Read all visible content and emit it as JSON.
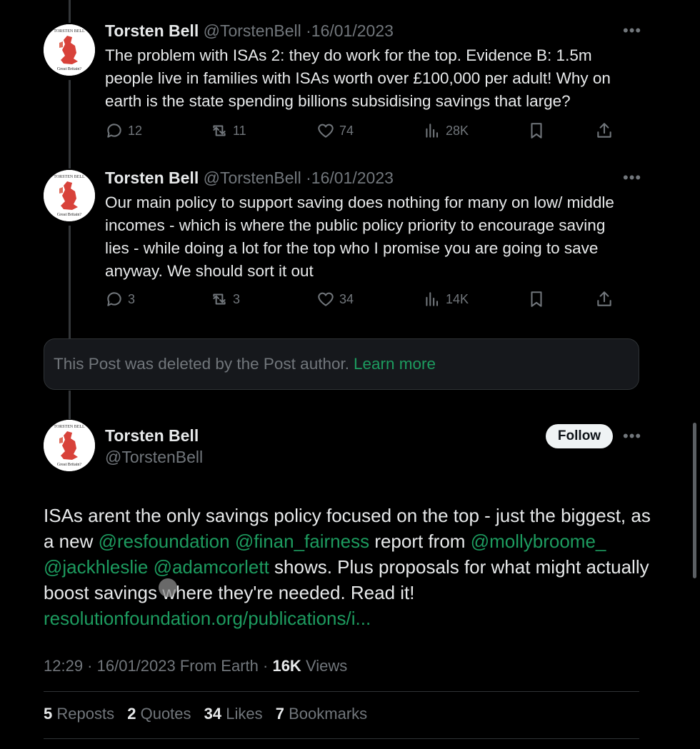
{
  "tweets": [
    {
      "name": "Torsten Bell",
      "handle": "@TorstenBell",
      "date_sep": "·",
      "date": "16/01/2023",
      "text": "The problem with ISAs 2: they do work for the top. Evidence B: 1.5m people live in families with ISAs worth over £100,000 per adult! Why on earth is the state spending billions subsidising savings that large?",
      "replies": "12",
      "reposts": "11",
      "likes": "74",
      "views": "28K"
    },
    {
      "name": "Torsten Bell",
      "handle": "@TorstenBell",
      "date_sep": "·",
      "date": "16/01/2023",
      "text": "Our main policy to support saving does nothing for many on low/ middle incomes - which is where the public policy priority to encourage saving lies - while doing a lot for the top who I promise you are going to save anyway. We should sort it out",
      "replies": "3",
      "reposts": "3",
      "likes": "34",
      "views": "14K"
    }
  ],
  "deleted_notice": {
    "text": "This Post was deleted by the Post author.",
    "link": "Learn more"
  },
  "main_tweet": {
    "name": "Torsten Bell",
    "handle": "@TorstenBell",
    "follow_label": "Follow",
    "text_1": "ISAs arent the only savings policy focused on the top - just the biggest, as a new ",
    "mention_1": "@resfoundation",
    "mention_2": "@finan_fairness",
    "text_2": " report from ",
    "mention_3": "@mollybroome_",
    "mention_4": "@jackhleslie",
    "mention_5": "@adamcorlett",
    "text_3": " shows. Plus proposals for what might actually boost savings where they're needed. Read it!",
    "url": "resolutionfoundation.org/publications/i...",
    "time": "12:29",
    "date": "16/01/2023",
    "source": "From Earth",
    "views_count": "16K",
    "views_label": "Views",
    "reposts_count": "5",
    "reposts_label": "Reposts",
    "quotes_count": "2",
    "quotes_label": "Quotes",
    "likes_count": "34",
    "likes_label": "Likes",
    "bookmarks_count": "7",
    "bookmarks_label": "Bookmarks"
  },
  "avatar": {
    "top_text": "TORSTEN BELL",
    "bottom_text": "Great Britain?"
  },
  "icons": [
    "reply-icon",
    "repost-icon",
    "like-icon",
    "views-icon",
    "bookmark-icon",
    "share-icon",
    "more-icon"
  ],
  "colors": {
    "background": "#000000",
    "text": "#e7e9ea",
    "muted": "#71767b",
    "link": "#1d9b5f",
    "follow_bg": "#eff3f4"
  }
}
